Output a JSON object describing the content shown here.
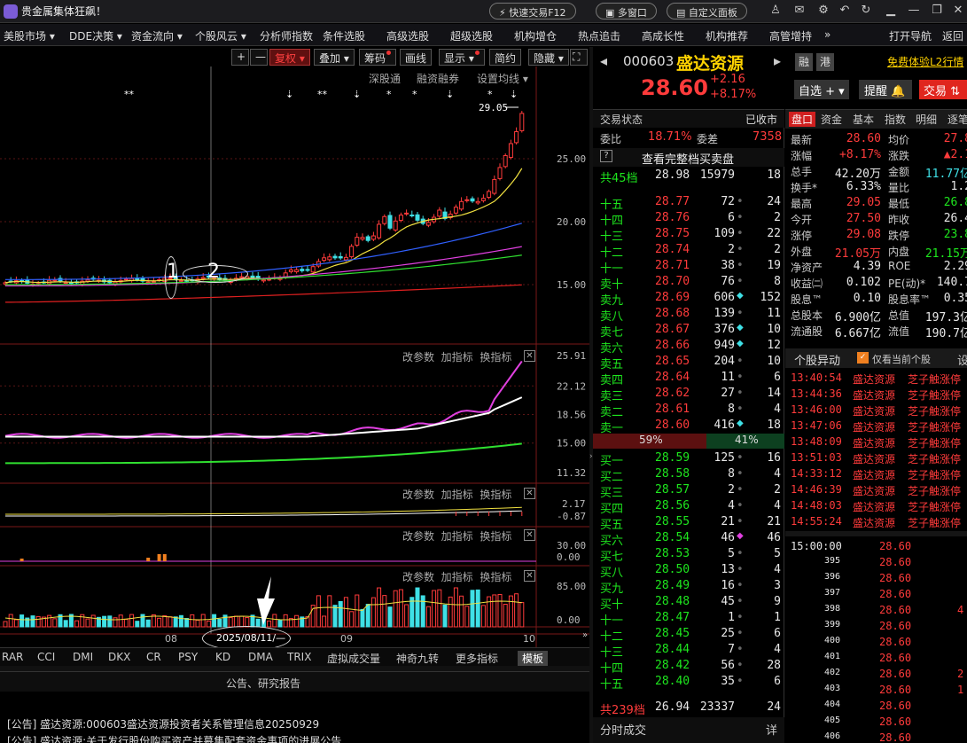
{
  "app": {
    "title": "贵金属集体狂飙！",
    "buttons": [
      "快速交易F12",
      "多窗口",
      "自定义面板"
    ]
  },
  "menu": [
    "美股市场",
    "DDE决策",
    "资金流向",
    "个股风云",
    "分析师指数",
    "条件选股",
    "高级选股",
    "超级选股",
    "机构增仓",
    "热点追击",
    "高成长性",
    "机构推荐",
    "高管增持",
    "»",
    "打开导航",
    "返回"
  ],
  "chart_toolbar": {
    "plus": "+",
    "minus": "—",
    "fuquan": "复权",
    "diejia": "叠加",
    "chouma": "筹码",
    "huaxian": "画线",
    "xianshi": "显示",
    "jianyue": "简约",
    "yincang": "隐藏",
    "expand": "⛶"
  },
  "chart_sublinks": {
    "a": "深股通",
    "b": "融资融券",
    "c": "设置均线"
  },
  "price_annotation": "29.05",
  "markers": {
    "one": "1",
    "two": "2",
    "date": "2025/08/11/—"
  },
  "yaxis": {
    "main": [
      "25.00",
      "20.00",
      "15.00"
    ],
    "macd": [
      "25.91",
      "22.12",
      "18.56",
      "15.00",
      "11.32"
    ],
    "p3": [
      "2.17",
      "-0.87"
    ],
    "p4": [
      "30.00",
      "0.00"
    ],
    "p5": [
      "85.00",
      "0.00"
    ]
  },
  "xaxis": [
    "08",
    "09",
    "10"
  ],
  "panel_btns": {
    "gaicanshu": "改参数",
    "jiazhibiao": "加指标",
    "huanzhibiao": "换指标",
    "close": "✕"
  },
  "indicator_tabs": [
    "RAR",
    "CCI",
    "DMI",
    "DKX",
    "CR",
    "PSY",
    "KD",
    "DMA",
    "TRIX",
    "虚拟成交量",
    "神奇九转",
    "更多指标",
    "模板"
  ],
  "news": {
    "title": "公告、研究报告",
    "items": [
      "[公告] 盛达资源:000603盛达资源投资者关系管理信息20250929",
      "[公告] 盛达资源:关于发行股份购买资产并募集配套资金事项的进展公告"
    ]
  },
  "stock": {
    "code": "000603",
    "name": "盛达资源",
    "price": "28.60",
    "change": "+2.16",
    "pct": "+8.17%",
    "tags": [
      "融",
      "港"
    ],
    "free": "免费体验L2行情",
    "zixuan": "自选",
    "tixing": "提醒",
    "jiaoyi": "交易"
  },
  "quote": {
    "status_label": "交易状态",
    "status_val": "已收市",
    "weibi_label": "委比",
    "weibi": "18.71%",
    "weicha_label": "委差",
    "weicha": "7358",
    "full_btn": "查看完整档买卖盘",
    "q": "?",
    "sell_total": {
      "label": "共45档",
      "price": "28.98",
      "vol": "15979",
      "n": "18"
    },
    "sells": [
      {
        "l": "十五",
        "p": "28.77",
        "v": "72",
        "d": "•",
        "n": "24"
      },
      {
        "l": "十四",
        "p": "28.76",
        "v": "6",
        "d": "•",
        "n": "2"
      },
      {
        "l": "十三",
        "p": "28.75",
        "v": "109",
        "d": "•",
        "n": "22"
      },
      {
        "l": "十二",
        "p": "28.74",
        "v": "2",
        "d": "•",
        "n": "2"
      },
      {
        "l": "十一",
        "p": "28.71",
        "v": "38",
        "d": "•",
        "n": "19"
      },
      {
        "l": "卖十",
        "p": "28.70",
        "v": "76",
        "d": "•",
        "n": "8"
      },
      {
        "l": "卖九",
        "p": "28.69",
        "v": "606",
        "d": "◆",
        "n": "152"
      },
      {
        "l": "卖八",
        "p": "28.68",
        "v": "139",
        "d": "•",
        "n": "11"
      },
      {
        "l": "卖七",
        "p": "28.67",
        "v": "376",
        "d": "◆",
        "n": "10"
      },
      {
        "l": "卖六",
        "p": "28.66",
        "v": "949",
        "d": "◆",
        "n": "12"
      },
      {
        "l": "卖五",
        "p": "28.65",
        "v": "204",
        "d": "•",
        "n": "10"
      },
      {
        "l": "卖四",
        "p": "28.64",
        "v": "11",
        "d": "•",
        "n": "6"
      },
      {
        "l": "卖三",
        "p": "28.62",
        "v": "27",
        "d": "•",
        "n": "14"
      },
      {
        "l": "卖二",
        "p": "28.61",
        "v": "8",
        "d": "•",
        "n": "4"
      },
      {
        "l": "卖一",
        "p": "28.60",
        "v": "416",
        "d": "◆",
        "n": "18"
      }
    ],
    "bar": {
      "sell": "59%",
      "buy": "41%"
    },
    "buys": [
      {
        "l": "买一",
        "p": "28.59",
        "v": "125",
        "d": "•",
        "n": "16"
      },
      {
        "l": "买二",
        "p": "28.58",
        "v": "8",
        "d": "•",
        "n": "4"
      },
      {
        "l": "买三",
        "p": "28.57",
        "v": "2",
        "d": "•",
        "n": "2"
      },
      {
        "l": "买四",
        "p": "28.56",
        "v": "4",
        "d": "•",
        "n": "4"
      },
      {
        "l": "买五",
        "p": "28.55",
        "v": "21",
        "d": "•",
        "n": "21"
      },
      {
        "l": "买六",
        "p": "28.54",
        "v": "46",
        "d": "◆",
        "n": "46"
      },
      {
        "l": "买七",
        "p": "28.53",
        "v": "5",
        "d": "•",
        "n": "5"
      },
      {
        "l": "买八",
        "p": "28.50",
        "v": "13",
        "d": "•",
        "n": "4"
      },
      {
        "l": "买九",
        "p": "28.49",
        "v": "16",
        "d": "•",
        "n": "3"
      },
      {
        "l": "买十",
        "p": "28.48",
        "v": "45",
        "d": "•",
        "n": "9"
      },
      {
        "l": "十一",
        "p": "28.47",
        "v": "1",
        "d": "•",
        "n": "1"
      },
      {
        "l": "十二",
        "p": "28.45",
        "v": "25",
        "d": "•",
        "n": "6"
      },
      {
        "l": "十三",
        "p": "28.44",
        "v": "7",
        "d": "•",
        "n": "4"
      },
      {
        "l": "十四",
        "p": "28.42",
        "v": "56",
        "d": "•",
        "n": "28"
      },
      {
        "l": "十五",
        "p": "28.40",
        "v": "35",
        "d": "•",
        "n": "6"
      }
    ],
    "buy_total": {
      "label": "共239档",
      "price": "26.94",
      "vol": "23337",
      "n": "24"
    },
    "fenshi": "分时成交",
    "detail": "详"
  },
  "panel": {
    "tabs": [
      "盘口",
      "资金",
      "基本",
      "指数",
      "明细",
      "逐笔"
    ],
    "rows": [
      [
        [
          "最新",
          "28.60"
        ],
        [
          "均价",
          "27.8"
        ]
      ],
      [
        [
          "涨幅",
          "+8.17%"
        ],
        [
          "涨跌",
          "▲2.1"
        ]
      ],
      [
        [
          "总手",
          "42.20万"
        ],
        [
          "金额",
          "11.77亿"
        ]
      ],
      [
        [
          "换手*",
          "6.33%"
        ],
        [
          "量比",
          "1.2"
        ]
      ],
      [
        [
          "最高",
          "29.05"
        ],
        [
          "最低",
          "26.8"
        ]
      ],
      [
        [
          "今开",
          "27.50"
        ],
        [
          "昨收",
          "26.4"
        ]
      ],
      [
        [
          "涨停",
          "29.08"
        ],
        [
          "跌停",
          "23.8"
        ]
      ],
      [
        [
          "外盘",
          "21.05万"
        ],
        [
          "内盘",
          "21.15万"
        ]
      ],
      [
        [
          "净资产",
          "4.39"
        ],
        [
          "ROE",
          "2.29"
        ]
      ],
      [
        [
          "收益㈡",
          "0.102"
        ],
        [
          "PE(动)*",
          "140.7"
        ]
      ],
      [
        [
          "股息™",
          "0.10"
        ],
        [
          "股息率™",
          "0.35"
        ]
      ],
      [
        [
          "总股本",
          "6.900亿"
        ],
        [
          "总值",
          "197.3亿"
        ]
      ],
      [
        [
          "流通股",
          "6.667亿"
        ],
        [
          "流值",
          "190.7亿"
        ]
      ]
    ],
    "ydhead": "个股异动",
    "ydcheck": "仅看当前个股",
    "ydset": "设",
    "yd": [
      [
        "13:40:54",
        "盛达资源",
        "芝子触涨停"
      ],
      [
        "13:44:36",
        "盛达资源",
        "芝子触涨停"
      ],
      [
        "13:46:00",
        "盛达资源",
        "芝子触涨停"
      ],
      [
        "13:47:06",
        "盛达资源",
        "芝子触涨停"
      ],
      [
        "13:48:09",
        "盛达资源",
        "芝子触涨停"
      ],
      [
        "13:51:03",
        "盛达资源",
        "芝子触涨停"
      ],
      [
        "14:33:12",
        "盛达资源",
        "芝子触涨停"
      ],
      [
        "14:46:39",
        "盛达资源",
        "芝子触涨停"
      ],
      [
        "14:48:03",
        "盛达资源",
        "芝子触涨停"
      ],
      [
        "14:55:24",
        "盛达资源",
        "芝子触涨停"
      ]
    ],
    "ticks": [
      [
        "15:00:00",
        "28.60",
        ""
      ],
      [
        "395",
        "28.60",
        ""
      ],
      [
        "396",
        "28.60",
        ""
      ],
      [
        "397",
        "28.60",
        ""
      ],
      [
        "398",
        "28.60",
        "4"
      ],
      [
        "399",
        "28.60",
        ""
      ],
      [
        "400",
        "28.60",
        ""
      ],
      [
        "401",
        "28.60",
        ""
      ],
      [
        "402",
        "28.60",
        "2"
      ],
      [
        "403",
        "28.60",
        "1"
      ],
      [
        "404",
        "28.60",
        ""
      ],
      [
        "405",
        "28.60",
        ""
      ],
      [
        "406",
        "28.60",
        ""
      ]
    ]
  },
  "colors": {
    "up": "#ff3b3b",
    "down": "#1ee61e",
    "cyan": "#3fe0e6",
    "ma5": "#ffffff",
    "ma10": "#f0e040",
    "ma20": "#e040e0",
    "ma30": "#30e030",
    "ma60": "#3060ff",
    "ma120": "#e02020"
  }
}
